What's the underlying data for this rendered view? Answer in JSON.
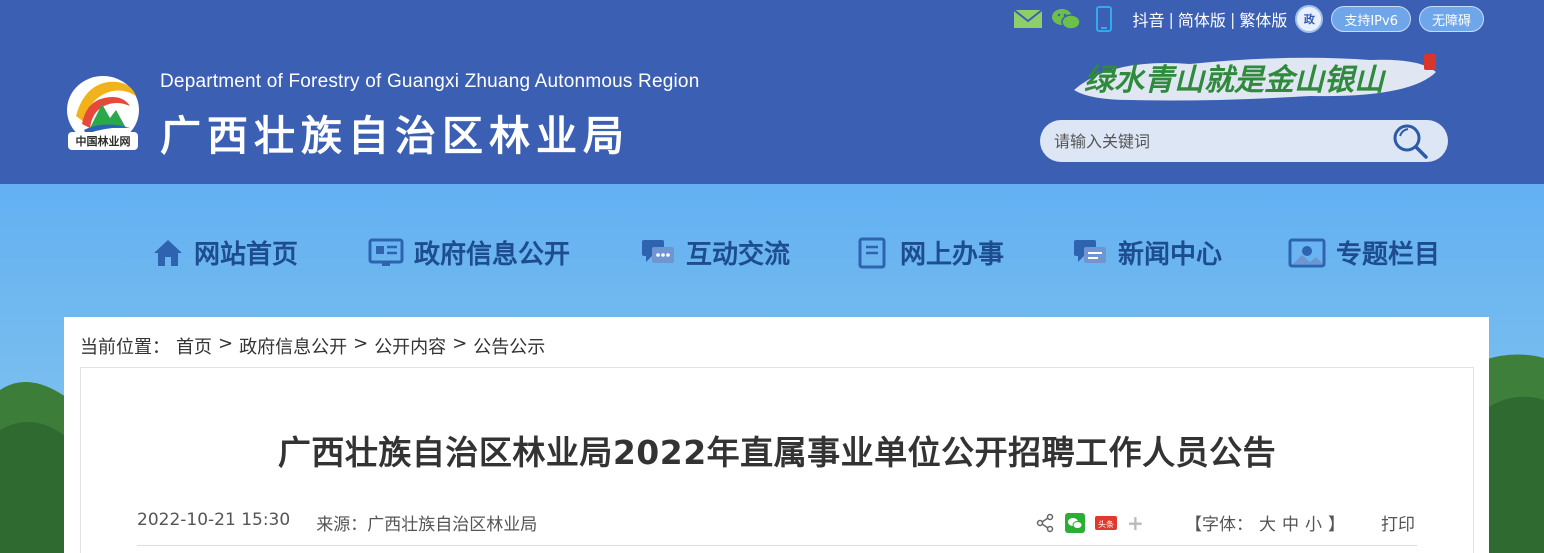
{
  "header": {
    "logo_badge": "中国林业网",
    "title_en": "Department of Forestry of Guangxi Zhuang Autonmous Region",
    "title_cn": "广西壮族自治区林业局",
    "slogan": "绿水青山就是金山银山",
    "top_links": [
      "抖音",
      "简体版",
      "繁体版"
    ],
    "top_link_separator": "|",
    "gov_badge_text": "政",
    "ipv6_label": "支持IPv6",
    "accessibility_label": "无障碍",
    "search_placeholder": "请输入关键词",
    "colors": {
      "header_bg": "#3b5fb3",
      "nav_text": "#1d4d8f"
    }
  },
  "nav": {
    "items": [
      {
        "label": "网站首页",
        "icon": "home-icon"
      },
      {
        "label": "政府信息公开",
        "icon": "monitor-icon"
      },
      {
        "label": "互动交流",
        "icon": "chat-icon"
      },
      {
        "label": "网上办事",
        "icon": "document-icon"
      },
      {
        "label": "新闻中心",
        "icon": "message-icon"
      },
      {
        "label": "专题栏目",
        "icon": "picture-icon"
      }
    ]
  },
  "breadcrumb": {
    "prefix": "当前位置：",
    "items": [
      "首页",
      "政府信息公开",
      "公开内容",
      "公告公示"
    ],
    "separator": ">"
  },
  "article": {
    "title": "广西壮族自治区林业局2022年直属事业单位公开招聘工作人员公告",
    "datetime": "2022-10-21 15:30",
    "source": "来源：广西壮族自治区林业局",
    "share_badge": "头条",
    "share_plus": "+",
    "font_size_label_open": "【字体：",
    "font_sizes": [
      "大",
      "中",
      "小"
    ],
    "font_size_label_close": "】",
    "print_label": "打印"
  }
}
